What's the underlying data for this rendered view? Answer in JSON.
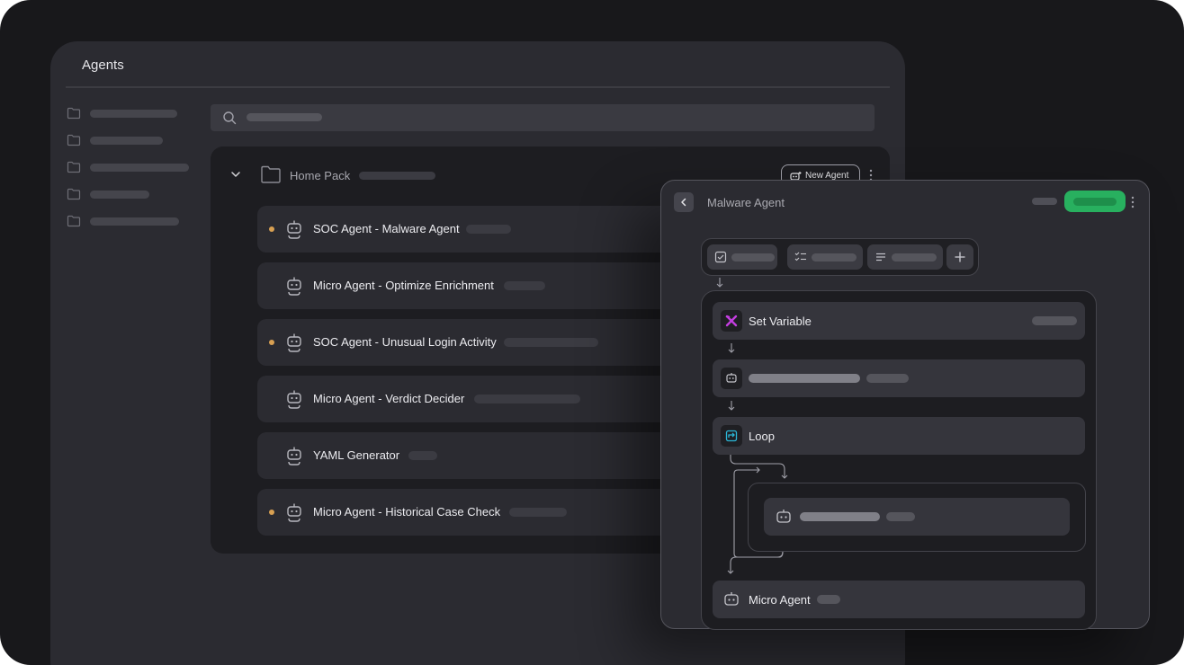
{
  "agents_window": {
    "title": "Agents"
  },
  "pack": {
    "name": "Home Pack",
    "new_agent_label": "New Agent"
  },
  "agent_rows": [
    {
      "name": "SOC Agent - Malware Agent",
      "status_dot": true
    },
    {
      "name": "Micro Agent - Optimize Enrichment",
      "status_dot": false
    },
    {
      "name": "SOC Agent - Unusual Login Activity",
      "status_dot": true
    },
    {
      "name": "Micro Agent - Verdict Decider",
      "status_dot": false
    },
    {
      "name": "YAML Generator",
      "status_dot": false
    },
    {
      "name": "Micro Agent - Historical Case Check",
      "status_dot": true
    }
  ],
  "panel": {
    "title": "Malware Agent",
    "nodes": {
      "set_variable": "Set Variable",
      "loop": "Loop",
      "micro_agent": "Micro Agent"
    }
  },
  "colors": {
    "background": "#18181b",
    "window": "#2b2b31",
    "status_dot": "#d8a052",
    "run_button": "#28b05f",
    "set_variable_icon": "#c43ee0",
    "loop_icon": "#2bb6d6"
  },
  "icons": [
    "folder-icon",
    "search-icon",
    "chevron-down-icon",
    "bot-icon",
    "more-vertical-icon",
    "chevron-left-icon",
    "checkbox-icon",
    "checklist-icon",
    "list-icon",
    "plus-icon",
    "variable-icon",
    "loop-icon",
    "arrow-down-icon"
  ]
}
